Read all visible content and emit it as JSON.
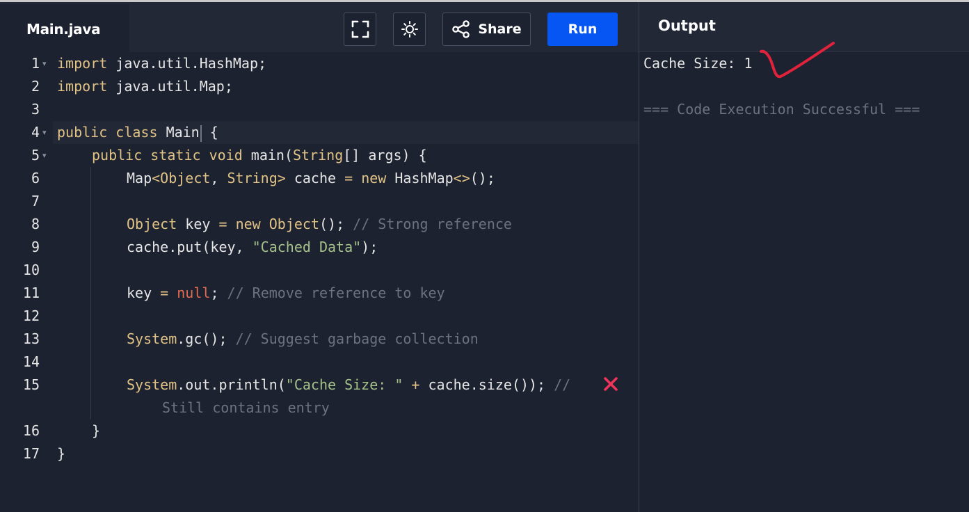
{
  "editor": {
    "file_tab": "Main.java",
    "lines": [
      {
        "num": "1",
        "fold": true
      },
      {
        "num": "2",
        "fold": false
      },
      {
        "num": "3",
        "fold": false
      },
      {
        "num": "4",
        "fold": true
      },
      {
        "num": "5",
        "fold": true
      },
      {
        "num": "6",
        "fold": false
      },
      {
        "num": "7",
        "fold": false
      },
      {
        "num": "8",
        "fold": false
      },
      {
        "num": "9",
        "fold": false
      },
      {
        "num": "10",
        "fold": false
      },
      {
        "num": "11",
        "fold": false
      },
      {
        "num": "12",
        "fold": false
      },
      {
        "num": "13",
        "fold": false
      },
      {
        "num": "14",
        "fold": false
      },
      {
        "num": "15",
        "fold": false
      },
      {
        "num": "16",
        "fold": false
      },
      {
        "num": "17",
        "fold": false
      }
    ],
    "code": {
      "l1_kw": "import",
      "l1_rest": " java.util.HashMap;",
      "l2_kw": "import",
      "l2_rest": " java.util.Map;",
      "l4_kw1": "public",
      "l4_kw2": "class",
      "l4_name": "Main",
      "l4_brace": " {",
      "l5_kw1": "public",
      "l5_kw2": "static",
      "l5_kw3": "void",
      "l5_name": " main(",
      "l5_type": "String",
      "l5_rest": "[] args) {",
      "l6_a": "Map",
      "l6_b": "<Object",
      "l6_c": ", ",
      "l6_d": "String",
      "l6_e": ">",
      "l6_f": " cache ",
      "l6_g": "=",
      "l6_h": " ",
      "l6_i": "new",
      "l6_j": " HashMap",
      "l6_k": "<>",
      "l6_l": "();",
      "l8_a": "Object",
      "l8_b": " key ",
      "l8_c": "=",
      "l8_d": " ",
      "l8_e": "new",
      "l8_f": " ",
      "l8_g": "Object",
      "l8_h": "(); ",
      "l8_cmt": "// Strong reference",
      "l9_a": "cache.put(key, ",
      "l9_str": "\"Cached Data\"",
      "l9_b": ");",
      "l11_a": "key ",
      "l11_op": "=",
      "l11_sp": " ",
      "l11_nul": "null",
      "l11_b": "; ",
      "l11_cmt": "// Remove reference to key",
      "l13_a": "System",
      "l13_b": ".gc(); ",
      "l13_cmt": "// Suggest garbage collection",
      "l15_a": "System",
      "l15_b": ".out.println(",
      "l15_str": "\"Cache Size: \"",
      "l15_c": " ",
      "l15_op": "+",
      "l15_d": " cache.size()); ",
      "l15_cmt": "//",
      "l15_wrap_cmt": "Still contains entry",
      "l16": "}",
      "l17": "}"
    }
  },
  "toolbar": {
    "share_label": "Share",
    "run_label": "Run"
  },
  "output": {
    "title": "Output",
    "result": "Cache Size: 1",
    "status": "=== Code Execution Successful ==="
  },
  "colors": {
    "run_button": "#0556f3",
    "annotation_red": "#e0233a",
    "cross_mark": "#f0335a"
  },
  "icons": {
    "fullscreen": "fullscreen-icon",
    "theme": "sun-icon",
    "share": "share-icon"
  }
}
